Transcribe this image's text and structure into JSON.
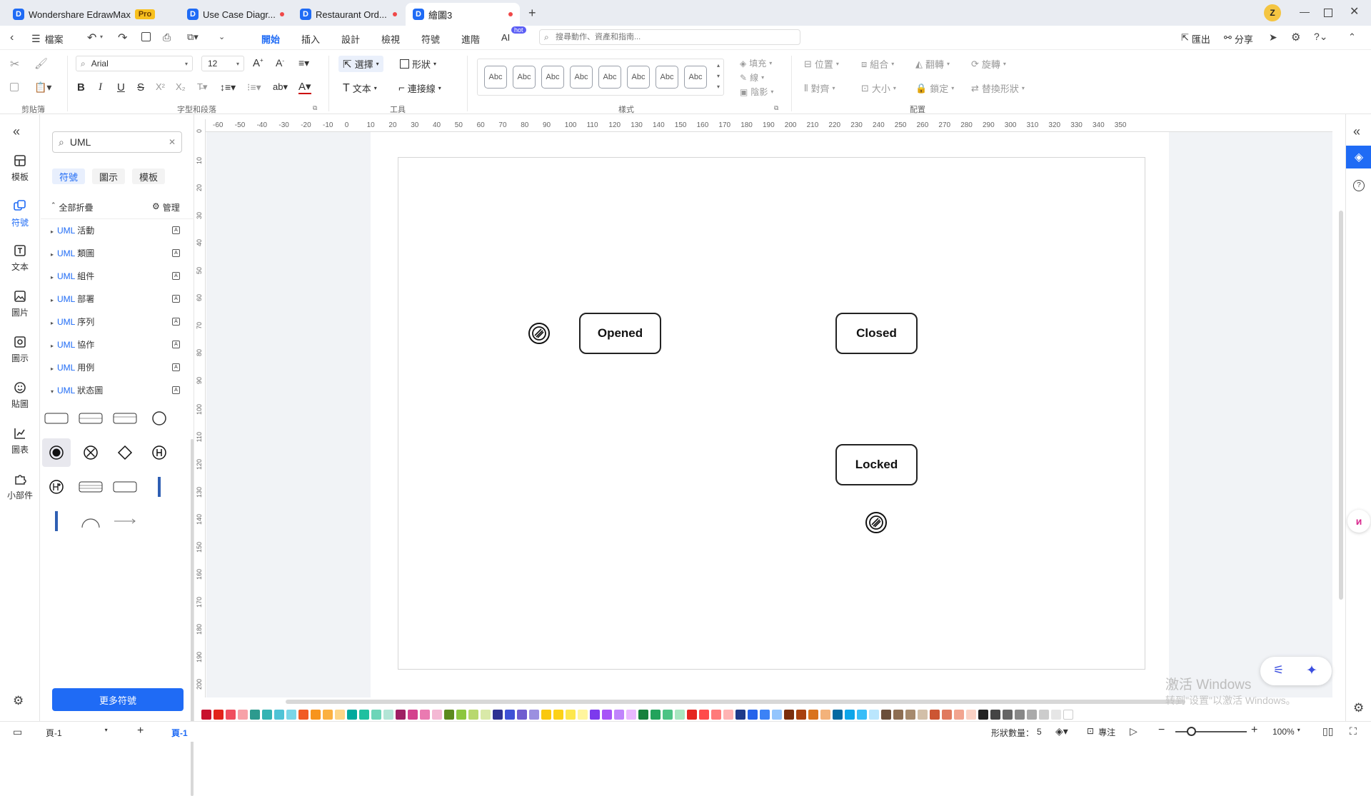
{
  "tabs": [
    {
      "label": "Wondershare EdrawMax",
      "badge": "Pro"
    },
    {
      "label": "Use Case Diagr..."
    },
    {
      "label": "Restaurant Ord..."
    },
    {
      "label": "繪圖3"
    }
  ],
  "user_initial": "Z",
  "menu": {
    "file": "檔案",
    "items": [
      "開始",
      "插入",
      "設計",
      "檢視",
      "符號",
      "進階"
    ],
    "ai": "AI",
    "ai_badge": "hot",
    "search_placeholder": "搜尋動作、資產和指南...",
    "export": "匯出",
    "share": "分享"
  },
  "ribbon": {
    "font": "Arial",
    "size": "12",
    "select": "選擇",
    "shape": "形狀",
    "text": "文本",
    "connector": "連接線",
    "abc": "Abc",
    "fill": "填充",
    "line": "線",
    "shadow": "陰影",
    "position": "位置",
    "group": "組合",
    "flip": "翻轉",
    "rotate": "旋轉",
    "align": "對齊",
    "size_btn": "大小",
    "lock": "鎖定",
    "replace": "替換形狀",
    "groups": {
      "clipboard": "剪貼簿",
      "font_para": "字型和段落",
      "tools": "工具",
      "style": "樣式",
      "arrange": "配置"
    }
  },
  "leftnav": [
    "模板",
    "符號",
    "文本",
    "圖片",
    "圖示",
    "貼圖",
    "圖表",
    "小部件"
  ],
  "panel": {
    "search": "UML",
    "tabs": [
      "符號",
      "圖示",
      "模板"
    ],
    "collapse_all": "全部折疊",
    "manage": "管理",
    "libs": [
      {
        "prefix": "UML",
        "name": "活動"
      },
      {
        "prefix": "UML",
        "name": "類圖"
      },
      {
        "prefix": "UML",
        "name": "組件"
      },
      {
        "prefix": "UML",
        "name": "部署"
      },
      {
        "prefix": "UML",
        "name": "序列"
      },
      {
        "prefix": "UML",
        "name": "協作"
      },
      {
        "prefix": "UML",
        "name": "用例"
      },
      {
        "prefix": "UML",
        "name": "狀态圖"
      }
    ],
    "more": "更多符號"
  },
  "ruler_h": [
    "-60",
    "-50",
    "-40",
    "-30",
    "-20",
    "-10",
    "0",
    "10",
    "20",
    "30",
    "40",
    "50",
    "60",
    "70",
    "80",
    "90",
    "100",
    "110",
    "120",
    "130",
    "140",
    "150",
    "160",
    "170",
    "180",
    "190",
    "200",
    "210",
    "220",
    "230",
    "240",
    "250",
    "260",
    "270",
    "280",
    "290",
    "300",
    "310",
    "320",
    "330",
    "340",
    "350"
  ],
  "ruler_v": [
    "0",
    "10",
    "20",
    "30",
    "40",
    "50",
    "60",
    "70",
    "80",
    "90",
    "100",
    "110",
    "120",
    "130",
    "140",
    "150",
    "160",
    "170",
    "180",
    "190",
    "200"
  ],
  "diagram": {
    "states": [
      "Opened",
      "Closed",
      "Locked"
    ]
  },
  "status": {
    "page_select": "頁-1",
    "page_tab": "頁-1",
    "shape_count_label": "形狀數量：",
    "shape_count": "5",
    "focus": "專注",
    "zoom": "100%"
  },
  "watermark": {
    "line1": "激活 Windows",
    "line2": "转到\"设置\"以激活 Windows。"
  },
  "palette": [
    "#c8102e",
    "#e2231a",
    "#f04e5e",
    "#f7a1a8",
    "#2d9a8e",
    "#35b3b3",
    "#4fc3d6",
    "#7ad6e8",
    "#f15a24",
    "#f7941d",
    "#fbb040",
    "#fdd587",
    "#00a99d",
    "#1fc0a0",
    "#6dd5b8",
    "#b3e5d6",
    "#9e1f63",
    "#d4418e",
    "#ea7ab1",
    "#f4b8d4",
    "#5c8a1e",
    "#8cc63f",
    "#b8d86e",
    "#d9e9a8",
    "#2e3192",
    "#3f51d6",
    "#6f5ccf",
    "#9b8fe0",
    "#f9c80e",
    "#fcd116",
    "#fde74c",
    "#fff59d",
    "#7c3aed",
    "#a855f7",
    "#c084fc",
    "#e9b8ff",
    "#16803c",
    "#22a35c",
    "#4cc384",
    "#a8e6c0",
    "#e52521",
    "#ff4b4b",
    "#ff7a7a",
    "#ffb3b3",
    "#1e3a8a",
    "#2563eb",
    "#3b82f6",
    "#93c5fd",
    "#7a2e0e",
    "#a8410f",
    "#d9731c",
    "#f3b27a",
    "#0369a1",
    "#0ea5e9",
    "#38bdf8",
    "#bae6fd",
    "#6b4f3a",
    "#8d6e53",
    "#a68a6d",
    "#d2bfa8",
    "#cc5533",
    "#e07a5f",
    "#f2a48f",
    "#fad1c4",
    "#222222",
    "#444444",
    "#666666",
    "#888888",
    "#aaaaaa",
    "#cccccc",
    "#e6e6e6",
    "#ffffff"
  ]
}
